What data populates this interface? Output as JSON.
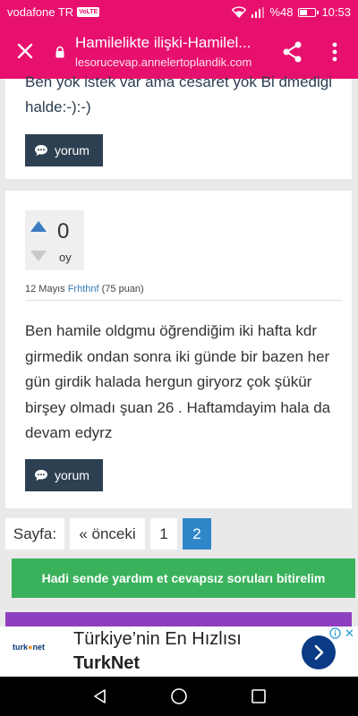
{
  "status": {
    "carrier": "vodafone TR",
    "volte_badge": "VoLTE",
    "battery": "%48",
    "battery_level": 0.48,
    "time": "10:53"
  },
  "browser": {
    "title": "Hamilelikte ilişki-Hamilel...",
    "url": "lesorucevap.annelertoplandik.com",
    "icons": [
      "close-icon",
      "lock-icon",
      "share-icon",
      "more-vert-icon"
    ]
  },
  "prev_comment": {
    "text": "Ben yok istek var ama cesaret yok Bi dmedigi halde:-):-)",
    "comment_label": "yorum"
  },
  "answer": {
    "votes": "0",
    "votes_label": "oy",
    "date": "12 Mayıs",
    "user": "Frhthnf",
    "points": "(75 puan)",
    "text": "Ben hamile oldgmu öğrendiğim iki hafta kdr girmedik ondan sonra iki günde bir bazen her gün girdik halada hergun giryorz çok şükür birşey olmadı şuan 26 . Haftamdayim hala da devam edyrz",
    "comment_label": "yorum"
  },
  "pagination": {
    "label": "Sayfa:",
    "prev": "« önceki",
    "pages": [
      "1",
      "2"
    ],
    "active": "2"
  },
  "cta": "Hadi sende yardım et cevapsız soruları bitirelim",
  "ad": {
    "logo": "turk",
    "logo_suffix": "net",
    "title": "Türkiye’nin En Hızlısı",
    "brand": "TurkNet"
  },
  "colors": {
    "brand_pink": "#e8106e",
    "button_dark": "#2d4052",
    "active_page": "#2f86c8",
    "cta_green": "#3ab25c",
    "ad_blue": "#0a3b84"
  }
}
